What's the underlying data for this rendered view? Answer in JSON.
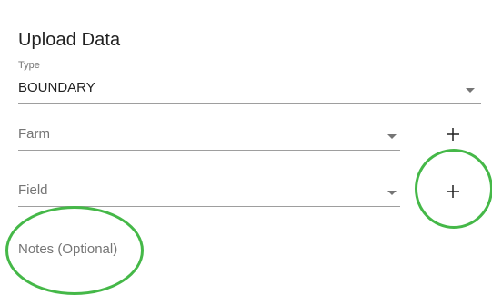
{
  "form": {
    "title": "Upload Data",
    "type": {
      "label": "Type",
      "value": "BOUNDARY"
    },
    "farm": {
      "placeholder": "Farm",
      "add_icon": "plus-icon"
    },
    "field": {
      "placeholder": "Field",
      "add_icon": "plus-icon"
    },
    "notes": {
      "placeholder": "Notes (Optional)"
    }
  },
  "annotation": {
    "highlight_color": "#45b848"
  }
}
